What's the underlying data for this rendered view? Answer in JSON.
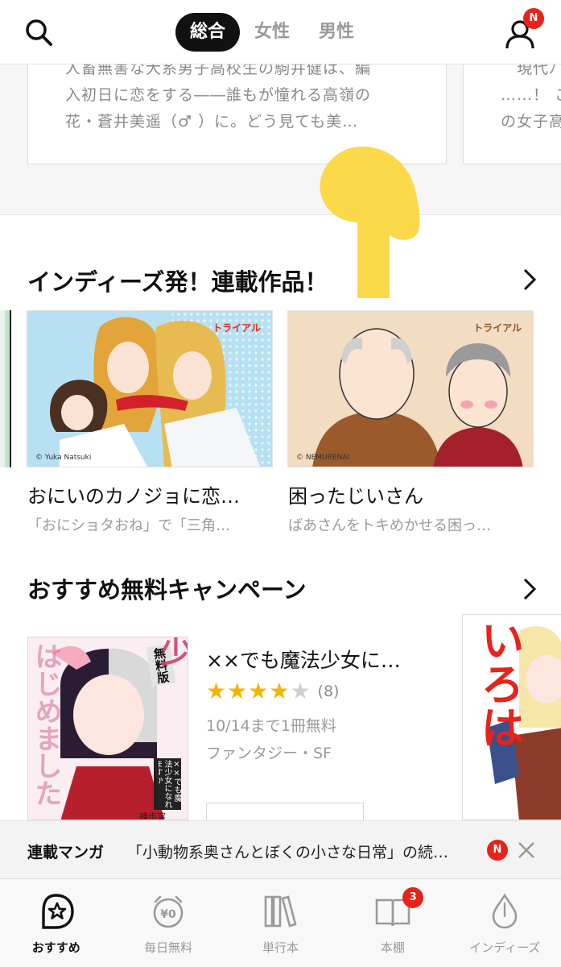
{
  "header": {
    "tabs": [
      {
        "label": "総合",
        "active": true
      },
      {
        "label": "女性",
        "active": false
      },
      {
        "label": "男性",
        "active": false
      }
    ],
    "profile_badge": "N",
    "icons": {
      "search": "search-icon",
      "profile": "user-icon"
    }
  },
  "top_cards": {
    "left_text_lines": [
      "人畜無害な犬系男子高校生の駒井健は、編",
      "入初日に恋をする――誰もが憧れる高嶺の",
      "花・蒼井美遥（♂ ）に。どう見ても美…"
    ],
    "right_text_lines": [
      "現代ﾉ",
      "……！ こ",
      "の女子高"
    ]
  },
  "indies": {
    "title": "インディーズ発！連載作品！",
    "items": [
      {
        "badge": "トライアル",
        "title": "おにいのカノジョに恋…",
        "subtitle": "「おにショタおね」で「三角…",
        "credit": "© Yuka Natsuki"
      },
      {
        "badge": "トライアル",
        "title": "困ったじいさん",
        "subtitle": "ばあさんをトキめかせる困っ…",
        "credit": "© NEMURENAI"
      }
    ]
  },
  "campaign": {
    "title": "おすすめ無料キャンペーン",
    "item": {
      "title": "××でも魔法少女に…",
      "rating": 4,
      "rating_max": 5,
      "rating_count": "(8)",
      "free_until": "10/14まで1冊無料",
      "genre": "ファンタジー・SF",
      "cover_badge": "無料版",
      "cover_text": "老後に魔法少",
      "cover_side_text": "はじめました",
      "cover_small_title": "××でも魔法少女になれますか",
      "cover_author": "棟歩実"
    },
    "right_cover_text": "いろは"
  },
  "notice": {
    "label": "連載マンガ",
    "text": "「小動物系奥さんとぼくの小さな日常」の続…",
    "badge": "N"
  },
  "bottom_nav": [
    {
      "label": "おすすめ",
      "icon": "star-bubble-icon",
      "active": true
    },
    {
      "label": "毎日無料",
      "icon": "yen-clock-icon",
      "active": false
    },
    {
      "label": "単行本",
      "icon": "books-icon",
      "active": false
    },
    {
      "label": "本棚",
      "icon": "open-book-icon",
      "active": false,
      "badge": "3"
    },
    {
      "label": "インディーズ",
      "icon": "drop-icon",
      "active": false
    }
  ],
  "colors": {
    "accent_red": "#e8231b",
    "star_yellow": "#f5b301",
    "star_gray": "#cfcfcf",
    "hand_yellow": "#fbd94a"
  }
}
